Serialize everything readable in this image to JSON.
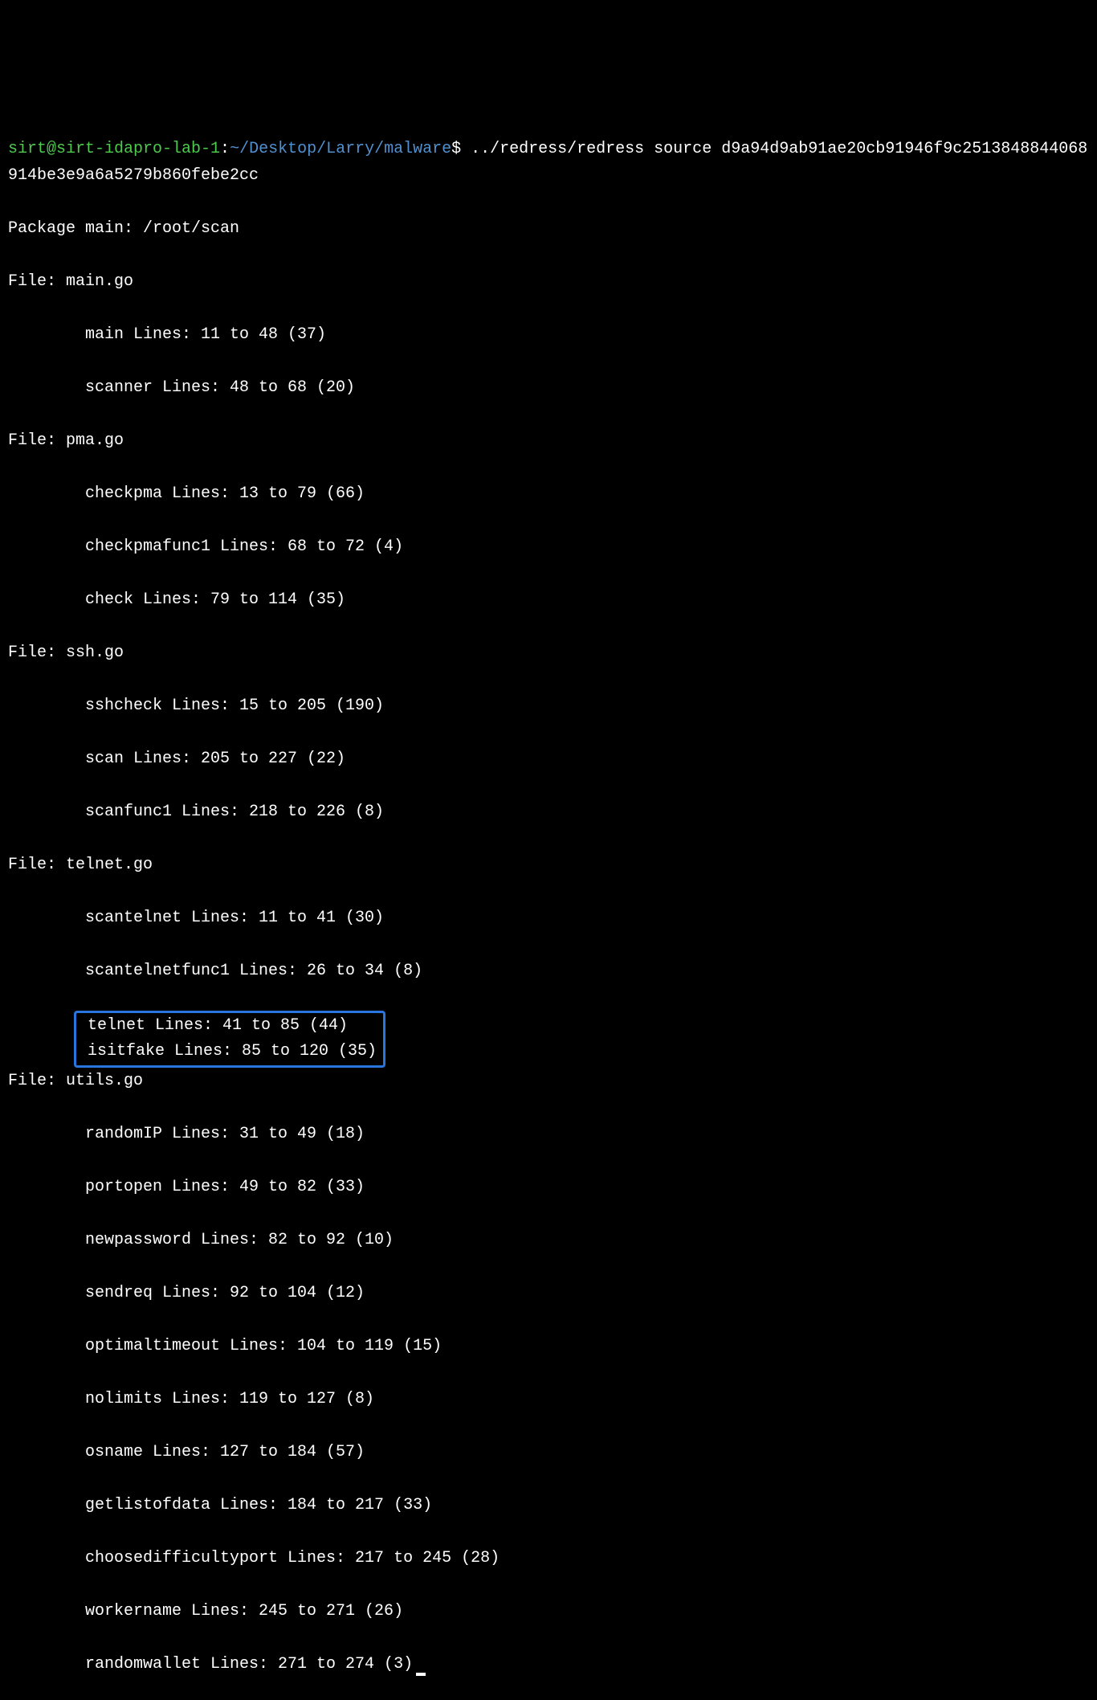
{
  "prompt": {
    "user_host": "sirt@sirt-idapro-lab-1",
    "separator": ":",
    "path": "~/Desktop/Larry/malware",
    "symbol": "$",
    "command": "../redress/redress source d9a94d9ab91ae20cb91946f9c2513848844068914be3e9a6a5279b860febe2cc"
  },
  "package_line": "Package main: /root/scan",
  "files": [
    {
      "header": "File: main.go",
      "functions": [
        "main Lines: 11 to 48 (37)",
        "scanner Lines: 48 to 68 (20)"
      ]
    },
    {
      "header": "File: pma.go",
      "functions": [
        "checkpma Lines: 13 to 79 (66)",
        "checkpmafunc1 Lines: 68 to 72 (4)",
        "check Lines: 79 to 114 (35)"
      ]
    },
    {
      "header": "File: ssh.go",
      "functions": [
        "sshcheck Lines: 15 to 205 (190)",
        "scan Lines: 205 to 227 (22)",
        "scanfunc1 Lines: 218 to 226 (8)"
      ]
    },
    {
      "header": "File: telnet.go",
      "functions": [
        "scantelnet Lines: 11 to 41 (30)",
        "scantelnetfunc1 Lines: 26 to 34 (8)"
      ],
      "highlighted": [
        "telnet Lines: 41 to 85 (44)",
        "isitfake Lines: 85 to 120 (35)"
      ]
    },
    {
      "header": "File: utils.go",
      "functions": [
        "randomIP Lines: 31 to 49 (18)",
        "portopen Lines: 49 to 82 (33)",
        "newpassword Lines: 82 to 92 (10)",
        "sendreq Lines: 92 to 104 (12)",
        "optimaltimeout Lines: 104 to 119 (15)",
        "nolimits Lines: 119 to 127 (8)",
        "osname Lines: 127 to 184 (57)",
        "getlistofdata Lines: 184 to 217 (33)",
        "choosedifficultyport Lines: 217 to 245 (28)",
        "workername Lines: 245 to 271 (26)",
        "randomwallet Lines: 271 to 274 (3)"
      ]
    }
  ]
}
